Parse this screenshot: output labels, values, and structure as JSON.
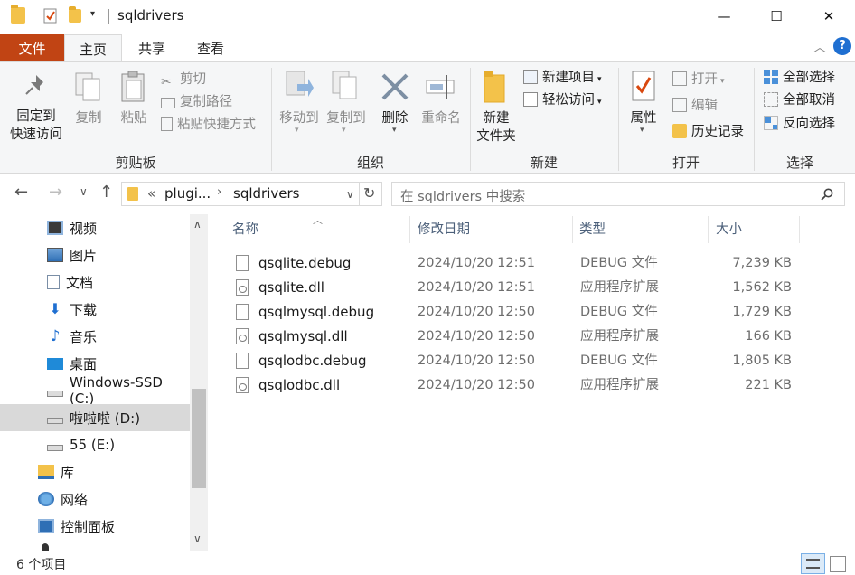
{
  "window": {
    "title": "sqldrivers",
    "minimize": "—",
    "maximize": "☐",
    "close": "✕"
  },
  "ribbon_tabs": [
    "文件",
    "主页",
    "共享",
    "查看"
  ],
  "ribbon": {
    "clipboard": {
      "pin": "固定到\n快速访问",
      "copy": "复制",
      "paste": "粘贴",
      "cut": "剪切",
      "copy_path": "复制路径",
      "paste_shortcut": "粘贴快捷方式",
      "label": "剪贴板"
    },
    "organize": {
      "move_to": "移动到",
      "copy_to": "复制到",
      "delete": "删除",
      "rename": "重命名",
      "label": "组织"
    },
    "new": {
      "new_folder": "新建\n文件夹",
      "new_item": "新建项目",
      "easy_access": "轻松访问",
      "label": "新建"
    },
    "open": {
      "properties": "属性",
      "open": "打开",
      "edit": "编辑",
      "history": "历史记录",
      "label": "打开"
    },
    "select": {
      "select_all": "全部选择",
      "select_none": "全部取消",
      "invert": "反向选择",
      "label": "选择"
    }
  },
  "address": {
    "prefix": "«",
    "crumb1": "plugi...",
    "crumb2": "sqldrivers",
    "search_placeholder": "在 sqldrivers 中搜索"
  },
  "nav_items": [
    {
      "label": "视频",
      "icon": "video-icon"
    },
    {
      "label": "图片",
      "icon": "pictures-icon"
    },
    {
      "label": "文档",
      "icon": "documents-icon"
    },
    {
      "label": "下载",
      "icon": "download-icon"
    },
    {
      "label": "音乐",
      "icon": "music-icon"
    },
    {
      "label": "桌面",
      "icon": "desktop-icon"
    },
    {
      "label": "Windows-SSD (C:)",
      "icon": "drive-icon"
    },
    {
      "label": "啦啦啦 (D:)",
      "icon": "drive-icon"
    },
    {
      "label": "55 (E:)",
      "icon": "drive-icon"
    },
    {
      "label": "库",
      "icon": "library-icon"
    },
    {
      "label": "网络",
      "icon": "network-icon"
    },
    {
      "label": "控制面板",
      "icon": "control-panel-icon"
    }
  ],
  "columns": {
    "name": "名称",
    "date": "修改日期",
    "type": "类型",
    "size": "大小"
  },
  "files": [
    {
      "name": "qsqlite.debug",
      "date": "2024/10/20 12:51",
      "type": "DEBUG 文件",
      "size": "7,239 KB",
      "kind": "debug"
    },
    {
      "name": "qsqlite.dll",
      "date": "2024/10/20 12:51",
      "type": "应用程序扩展",
      "size": "1,562 KB",
      "kind": "dll"
    },
    {
      "name": "qsqlmysql.debug",
      "date": "2024/10/20 12:50",
      "type": "DEBUG 文件",
      "size": "1,729 KB",
      "kind": "debug"
    },
    {
      "name": "qsqlmysql.dll",
      "date": "2024/10/20 12:50",
      "type": "应用程序扩展",
      "size": "166 KB",
      "kind": "dll"
    },
    {
      "name": "qsqlodbc.debug",
      "date": "2024/10/20 12:50",
      "type": "DEBUG 文件",
      "size": "1,805 KB",
      "kind": "debug"
    },
    {
      "name": "qsqlodbc.dll",
      "date": "2024/10/20 12:50",
      "type": "应用程序扩展",
      "size": "221 KB",
      "kind": "dll"
    }
  ],
  "status": {
    "count": "6 个项目"
  }
}
